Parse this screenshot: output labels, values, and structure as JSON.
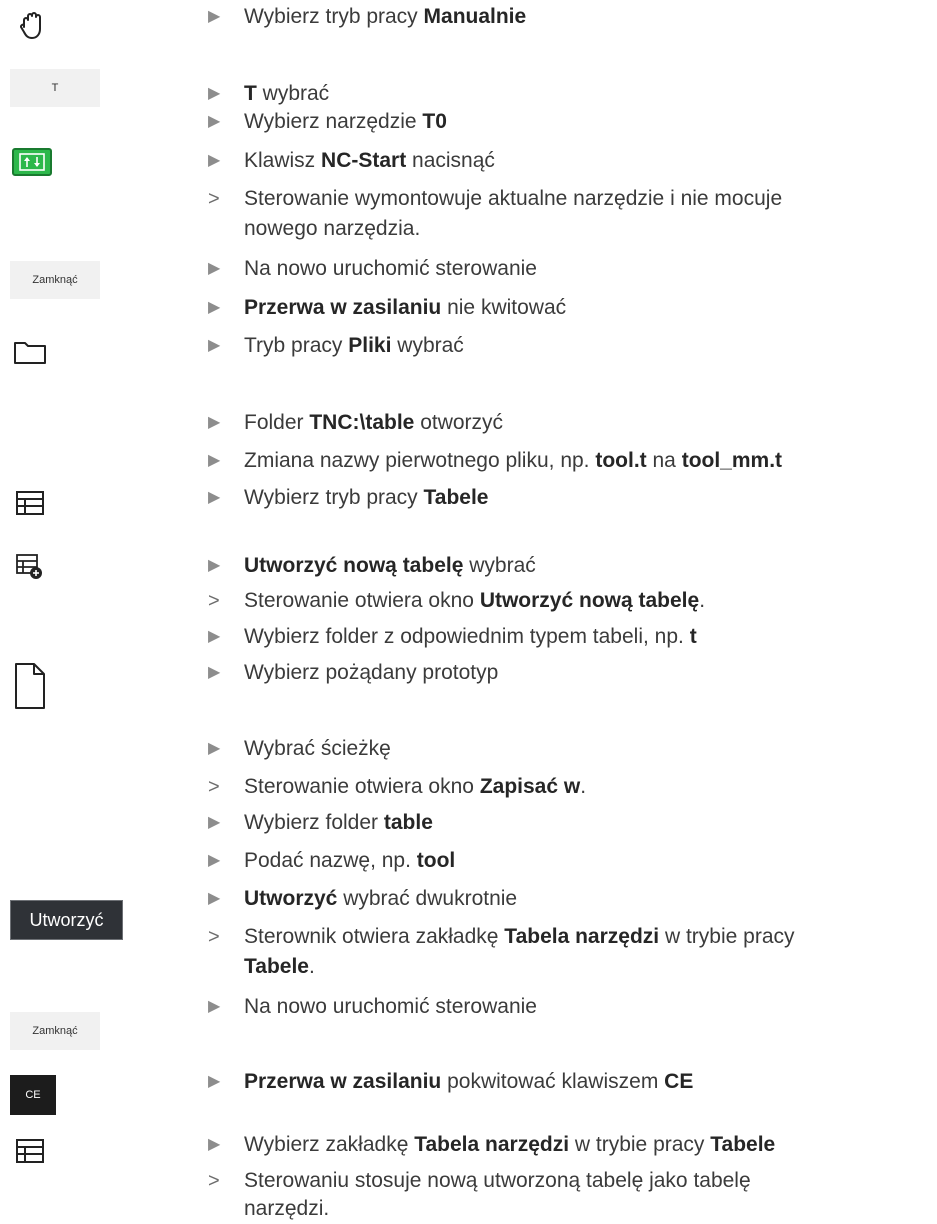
{
  "icons": {
    "hand": "hand-manual-icon",
    "t_key_label": "T",
    "nc_start": "nc-start-icon",
    "close1_label": "Zamknąć",
    "folder": "folder-icon",
    "table1": "table-icon",
    "table_add": "table-add-icon",
    "file": "file-icon",
    "create_label": "Utworzyć",
    "close2_label": "Zamknąć",
    "ce_label": "CE",
    "table2": "table-icon"
  },
  "steps": [
    {
      "type": "action",
      "parts": [
        "Wybierz tryb pracy ",
        "Manualnie"
      ]
    },
    {
      "type": "action",
      "parts": [
        "T",
        " wybrać"
      ]
    },
    {
      "type": "action",
      "parts": [
        "Wybierz narzędzie ",
        "T0"
      ]
    },
    {
      "type": "action",
      "parts": [
        "Klawisz ",
        "NC-Start",
        " nacisnąć"
      ]
    },
    {
      "type": "result",
      "parts": [
        "Sterowanie wymontowuje aktualne narzędzie i nie mocuje"
      ],
      "continuation": "nowego narzędzia."
    },
    {
      "type": "action",
      "parts": [
        "Na nowo uruchomić sterowanie"
      ]
    },
    {
      "type": "action",
      "parts": [
        "Przerwa w zasilaniu",
        " nie kwitować"
      ]
    },
    {
      "type": "action",
      "parts": [
        "Tryb pracy ",
        "Pliki",
        " wybrać"
      ]
    },
    {
      "type": "action",
      "parts": [
        "Folder ",
        "TNC:\\table",
        " otworzyć"
      ]
    },
    {
      "type": "action",
      "parts": [
        "Zmiana nazwy pierwotnego pliku, np. ",
        "tool.t",
        " na ",
        "tool_mm.t"
      ]
    },
    {
      "type": "action",
      "parts": [
        "Wybierz tryb pracy ",
        "Tabele"
      ]
    },
    {
      "type": "action",
      "parts": [
        "Utworzyć nową tabelę",
        " wybrać"
      ]
    },
    {
      "type": "result",
      "parts": [
        "Sterowanie otwiera okno ",
        "Utworzyć nową tabelę",
        "."
      ]
    },
    {
      "type": "action",
      "parts": [
        "Wybierz folder z odpowiednim typem tabeli, np. ",
        "t"
      ]
    },
    {
      "type": "action",
      "parts": [
        "Wybierz pożądany prototyp"
      ]
    },
    {
      "type": "action",
      "parts": [
        "Wybrać ścieżkę"
      ]
    },
    {
      "type": "result",
      "parts": [
        "Sterowanie otwiera okno ",
        "Zapisać w",
        "."
      ]
    },
    {
      "type": "action",
      "parts": [
        "Wybierz folder ",
        "table"
      ]
    },
    {
      "type": "action",
      "parts": [
        "Podać nazwę, np. ",
        "tool"
      ]
    },
    {
      "type": "action",
      "parts": [
        "Utworzyć",
        " wybrać dwukrotnie"
      ]
    },
    {
      "type": "result",
      "parts": [
        "Sterownik otwiera zakładkę ",
        "Tabela narzędzi",
        " w trybie pracy"
      ],
      "continuation_parts": [
        "Tabele",
        "."
      ]
    },
    {
      "type": "action",
      "parts": [
        "Na nowo uruchomić sterowanie"
      ]
    },
    {
      "type": "action",
      "parts": [
        "Przerwa w zasilaniu",
        " pokwitować klawiszem ",
        "CE"
      ]
    },
    {
      "type": "action",
      "parts": [
        "Wybierz zakładkę ",
        "Tabela narzędzi",
        " w trybie pracy ",
        "Tabele"
      ]
    },
    {
      "type": "result",
      "parts": [
        "Sterowaniu stosuje nową utworzoną tabelę jako tabelę"
      ],
      "continuation": "narzędzi."
    }
  ]
}
